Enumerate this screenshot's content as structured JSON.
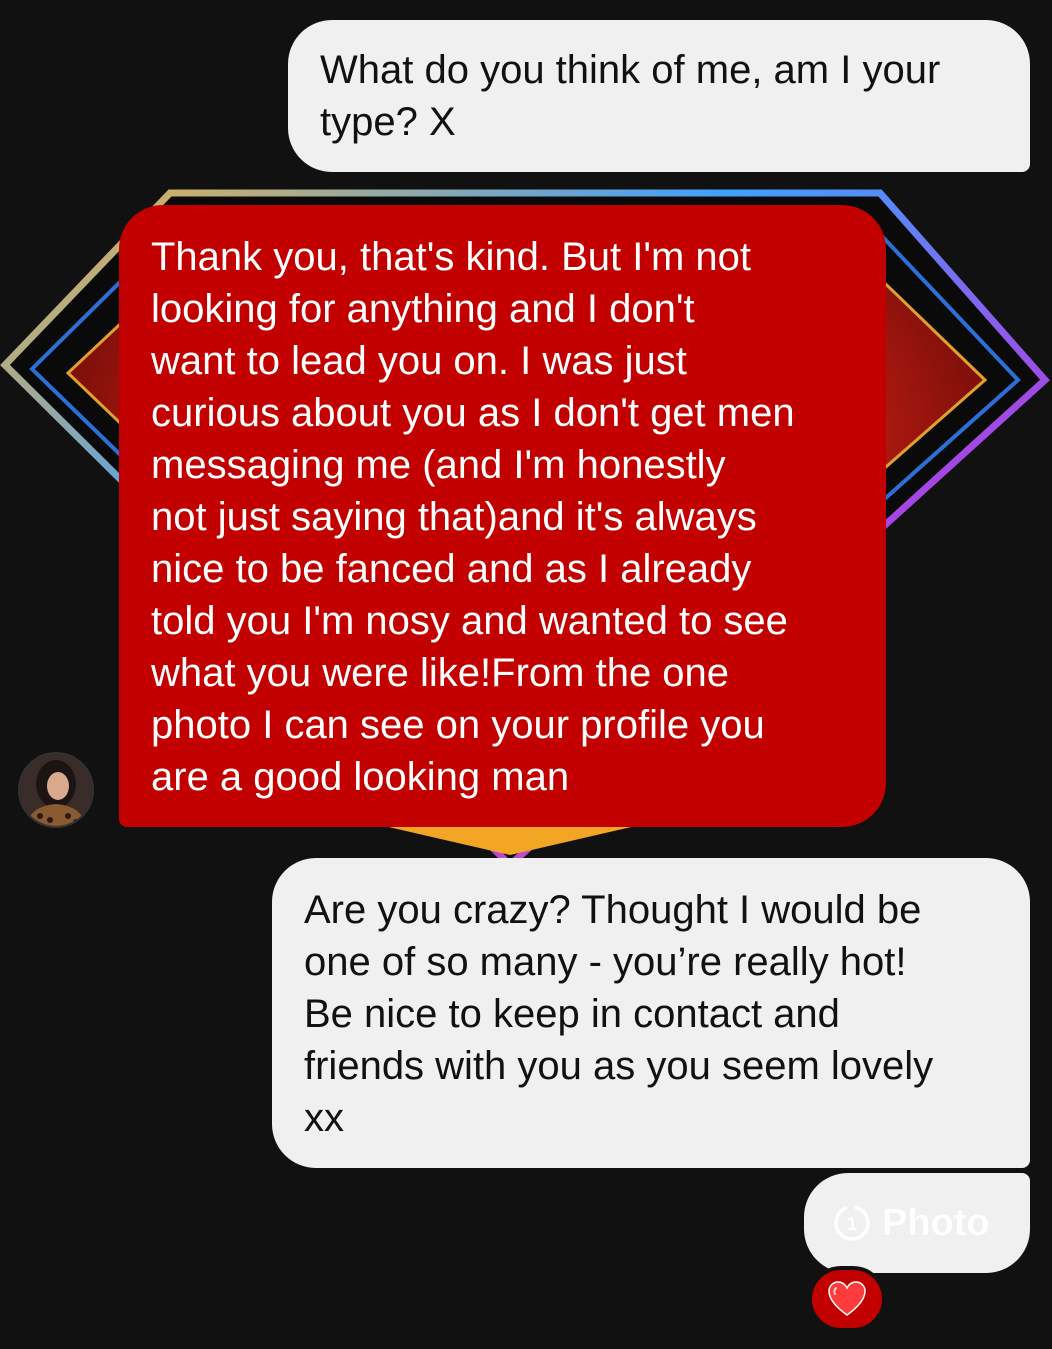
{
  "conversation": {
    "messages": [
      {
        "sender": "me",
        "text": "What do you think of me, am I your\ntype? X"
      },
      {
        "sender": "them",
        "text": "Thank you, that's kind. But I'm not\nlooking for anything and I don't\nwant to lead you on. I was just\ncurious about you as I don't get men\nmessaging me (and I'm honestly\nnot just saying that)and it's always\nnice to be fanced and as I already\ntold you I'm nosy and wanted to see\nwhat you were like!From the one\nphoto I can see on your profile you\nare a good looking man"
      },
      {
        "sender": "me",
        "text": "Are you crazy? Thought I would be\none of so many - you’re really hot!\nBe nice to keep in contact and\nfriends with you as you seem lovely\nxx"
      },
      {
        "sender": "me",
        "type": "photo",
        "label": "Photo",
        "icon": "view-once-icon"
      }
    ],
    "reaction": {
      "emoji": "❤️",
      "icon": "heart-icon"
    }
  },
  "colors": {
    "background": "#111111",
    "outgoing_bubble": "#f0f0f0",
    "incoming_bubble": "#c20000"
  }
}
